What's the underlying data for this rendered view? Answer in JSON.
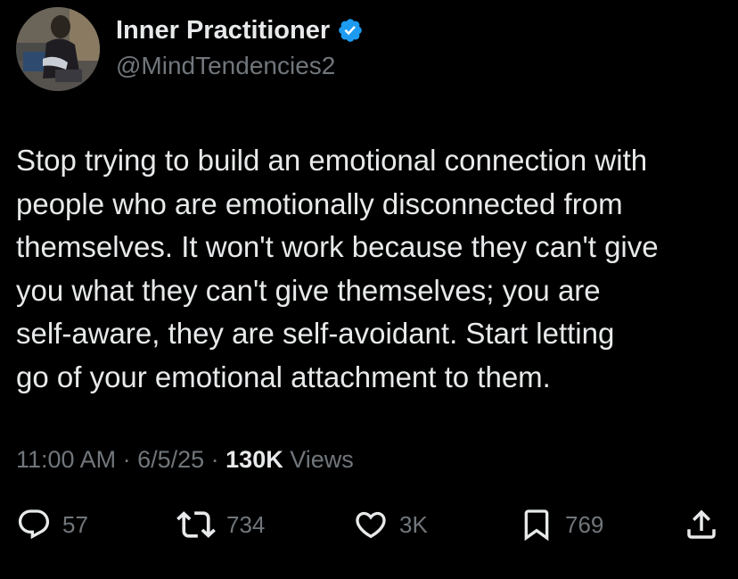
{
  "author": {
    "display_name": "Inner Practitioner",
    "handle": "@MindTendencies2",
    "verified_color": "#1d9bf0"
  },
  "tweet": {
    "text": "Stop trying to build an emotional connection with\npeople who are emotionally disconnected from\nthemselves. It won't work because they can't give\nyou what they can't give themselves; you are\nself-aware, they are self-avoidant. Start letting\ngo of your emotional attachment to them.",
    "time": "11:00 AM",
    "separator": " · ",
    "date": "6/5/25",
    "views_count": "130K",
    "views_label": " Views"
  },
  "actions": {
    "replies": "57",
    "reposts": "734",
    "likes": "3K",
    "bookmarks": "769"
  },
  "icons": {
    "reply": "speech-bubble",
    "repost": "repeat-arrows",
    "like": "heart-outline",
    "bookmark": "bookmark-outline",
    "share": "share-upload"
  },
  "colors": {
    "background": "#000000",
    "text": "#e7e9ea",
    "secondary": "#71767b",
    "accent": "#1d9bf0"
  }
}
